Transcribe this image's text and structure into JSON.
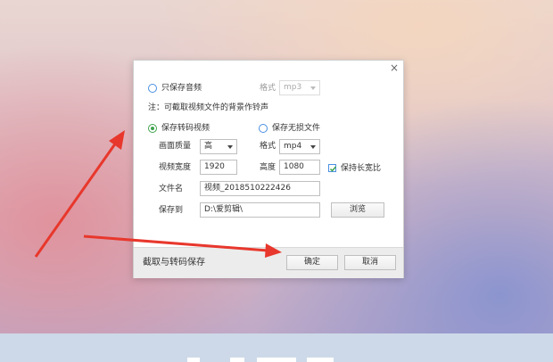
{
  "dialog": {
    "close_glyph": "×",
    "audio_only": {
      "label": "只保存音频",
      "format_label": "格式",
      "format_value": "mp3",
      "checked": false
    },
    "note": "注：可截取视频文件的背景作铃声",
    "transcode": {
      "label": "保存转码视频",
      "checked": true
    },
    "lossless": {
      "label": "保存无损文件",
      "checked": false
    },
    "quality": {
      "label": "画面质量",
      "value": "高"
    },
    "video_format": {
      "label": "格式",
      "value": "mp4"
    },
    "width": {
      "label": "视频宽度",
      "value": "1920"
    },
    "height": {
      "label": "高度",
      "value": "1080"
    },
    "keep_ratio": {
      "label": "保持长宽比",
      "checked": true
    },
    "filename": {
      "label": "文件名",
      "value": "视频_2018510222426"
    },
    "save_to": {
      "label": "保存到",
      "value": "D:\\爱剪辑\\"
    },
    "browse_label": "浏览",
    "footer_title": "截取与转码保存",
    "ok_label": "确定",
    "cancel_label": "取消"
  },
  "colors": {
    "arrow": "#e8372c",
    "radio_checked": "#3fa34d",
    "accent_border": "#4a90e2"
  }
}
